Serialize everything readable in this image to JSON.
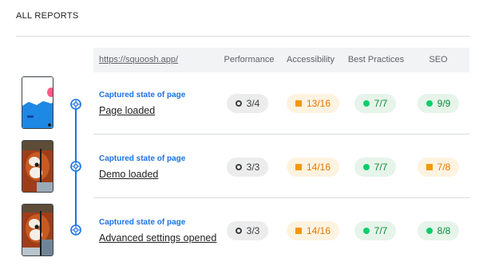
{
  "page": {
    "title": "ALL REPORTS"
  },
  "table": {
    "url": "https://squoosh.app/",
    "columns": [
      "Performance",
      "Accessibility",
      "Best Practices",
      "SEO"
    ]
  },
  "steps": [
    {
      "kind": "Captured state of page",
      "name": "Page loaded",
      "scores": [
        {
          "value": "3/4",
          "status": "neutral"
        },
        {
          "value": "13/16",
          "status": "average"
        },
        {
          "value": "7/7",
          "status": "pass"
        },
        {
          "value": "9/9",
          "status": "pass"
        }
      ]
    },
    {
      "kind": "Captured state of page",
      "name": "Demo loaded",
      "scores": [
        {
          "value": "3/3",
          "status": "neutral"
        },
        {
          "value": "14/16",
          "status": "average"
        },
        {
          "value": "7/7",
          "status": "pass"
        },
        {
          "value": "7/8",
          "status": "average"
        }
      ]
    },
    {
      "kind": "Captured state of page",
      "name": "Advanced settings opened",
      "scores": [
        {
          "value": "3/3",
          "status": "neutral"
        },
        {
          "value": "14/16",
          "status": "average"
        },
        {
          "value": "7/7",
          "status": "pass"
        },
        {
          "value": "8/8",
          "status": "pass"
        }
      ]
    }
  ],
  "icons": {
    "node": "snapshot-camera-icon",
    "neutral": "hollow-circle-icon",
    "average": "orange-square-icon",
    "pass": "green-circle-icon"
  },
  "colors": {
    "accent": "#1a73e8",
    "pass": "#0cce6b",
    "average": "#f29900",
    "neutral": "#3c4043"
  }
}
